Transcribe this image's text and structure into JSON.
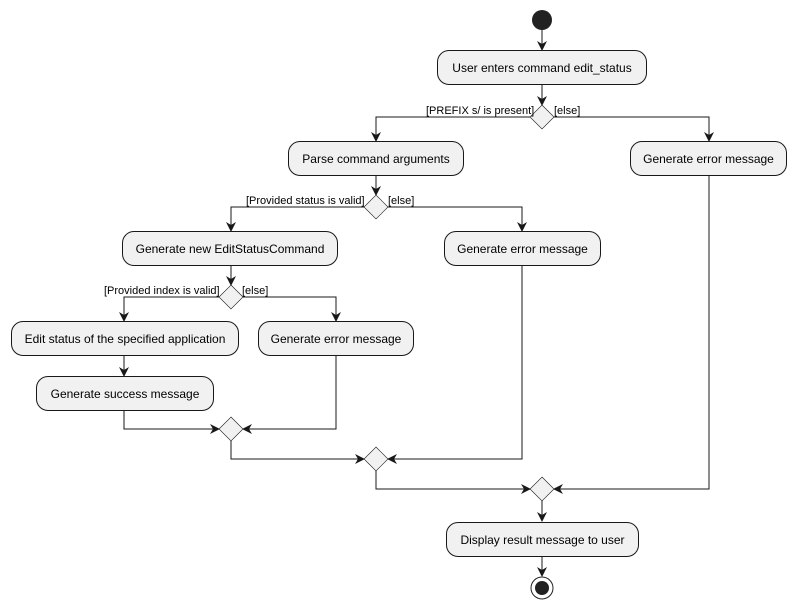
{
  "diagram": {
    "type": "activity",
    "start": "start",
    "end": "end",
    "actions": {
      "user_enters": "User enters command edit_status",
      "parse_args": "Parse command arguments",
      "error_prefix": "Generate error message",
      "gen_command": "Generate new EditStatusCommand",
      "error_status": "Generate error message",
      "edit_status": "Edit status of the specified application",
      "error_index": "Generate error message",
      "success_msg": "Generate success message",
      "display_result": "Display result message to user"
    },
    "guards": {
      "prefix_present": "[PREFIX s/ is present]",
      "prefix_else": "[else]",
      "status_valid": "[Provided status is valid]",
      "status_else": "[else]",
      "index_valid": "[Provided index is valid]",
      "index_else": "[else]"
    }
  }
}
